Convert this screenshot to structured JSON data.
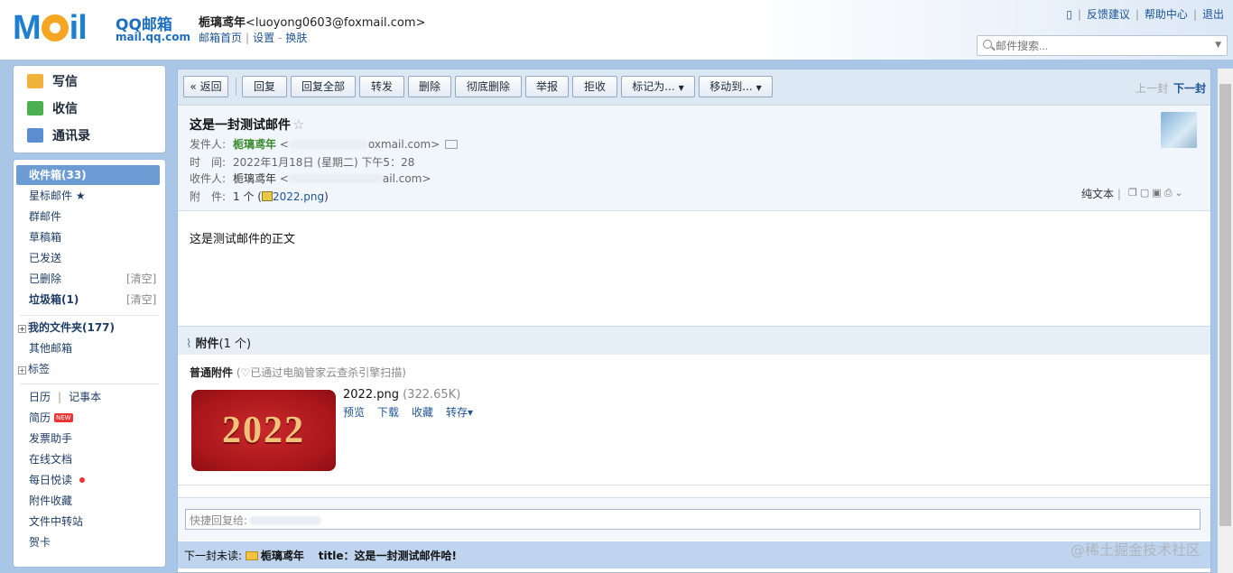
{
  "header": {
    "logo_text": "M",
    "logo_text2": "il",
    "brand": "QQ邮箱",
    "brand_url": "mail.qq.com",
    "user_name": "栀璃鸢年",
    "user_email": "<luoyong0603@foxmail.com>",
    "links": [
      "邮箱首页",
      "设置",
      "换肤"
    ],
    "top_links": [
      "反馈建议",
      "帮助中心",
      "退出"
    ],
    "search_placeholder": "邮件搜索..."
  },
  "sidebar": {
    "actions": [
      "写信",
      "收信",
      "通讯录"
    ],
    "folders": [
      {
        "label": "收件箱(33)"
      },
      {
        "label": "星标邮件 ★"
      },
      {
        "label": "群邮件"
      },
      {
        "label": "草稿箱"
      },
      {
        "label": "已发送"
      },
      {
        "label": "已删除",
        "clear": "[清空]"
      },
      {
        "label": "垃圾箱(1)",
        "clear": "[清空]"
      }
    ],
    "my_folders": "我的文件夹(177)",
    "other_mail": "其他邮箱",
    "tags": "标签",
    "tools": [
      "日历",
      "记事本",
      "简历",
      "发票助手",
      "在线文档",
      "每日悦读",
      "附件收藏",
      "文件中转站",
      "贺卡"
    ],
    "new_badge": "NEW"
  },
  "toolbar": {
    "buttons": [
      "« 返回",
      "回复",
      "回复全部",
      "转发",
      "删除",
      "彻底删除",
      "举报",
      "拒收",
      "标记为...",
      "移动到..."
    ],
    "prev": "上一封",
    "next": "下一封"
  },
  "mail": {
    "subject": "这是一封测试邮件",
    "from_label": "发件人:",
    "from_name": "栀璃鸢年",
    "from_email_pre": "<",
    "from_email_post": "oxmail.com>",
    "time_label": "时　间:",
    "time_value": "2022年1月18日 (星期二) 下午5：28",
    "to_label": "收件人:",
    "to_name": "栀璃鸢年",
    "to_email_pre": "<",
    "to_email_post": "ail.com>",
    "att_label": "附　件:",
    "att_value_pre": "1 个 (",
    "att_file": "2022.png",
    "att_value_post": ")",
    "pure_text": "纯文本",
    "body": "这是测试邮件的正文"
  },
  "attachments": {
    "title": "附件",
    "count": "(1 个)",
    "normal_label": "普通附件",
    "scan_note": "(♡已通过电脑管家云查杀引擎扫描)",
    "file_name": "2022.png",
    "file_size": "(322.65K)",
    "thumb_text": "2022",
    "actions": [
      "预览",
      "下载",
      "收藏",
      "转存▾"
    ]
  },
  "reply": {
    "placeholder": "快捷回复给:"
  },
  "next_unread": {
    "label": "下一封未读:",
    "sender": "栀璃鸢年",
    "title": "title：这是一封测试邮件哈!"
  },
  "watermark": "@稀土掘金技术社区"
}
